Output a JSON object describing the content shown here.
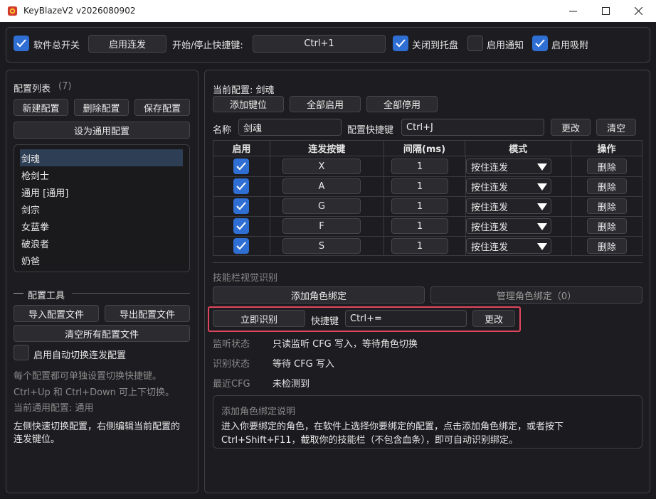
{
  "window": {
    "title": "KeyBlazeV2 v2026080902"
  },
  "toolbar": {
    "master_switch": {
      "label": "软件总开关",
      "checked": true
    },
    "enable_burst_button": "启用连发",
    "hotkey_label": "开始/停止快捷键:",
    "hotkey_value": "Ctrl+1",
    "close_to_tray": {
      "label": "关闭到托盘",
      "checked": true
    },
    "enable_notify": {
      "label": "启用通知",
      "checked": false
    },
    "enable_snap": {
      "label": "启用吸附",
      "checked": true
    }
  },
  "left": {
    "list_title": "配置列表",
    "list_count": "(7)",
    "new_button": "新建配置",
    "delete_button": "删除配置",
    "save_button": "保存配置",
    "set_general_button": "设为通用配置",
    "configs": [
      "剑魂",
      "枪剑士",
      "通用 [通用]",
      "剑宗",
      "女蓝拳",
      "破浪者",
      "奶爸"
    ],
    "selected_index": 0,
    "tools_title": "配置工具",
    "import_button": "导入配置文件",
    "export_button": "导出配置文件",
    "clear_button": "清空所有配置文件",
    "auto_switch": {
      "label": "启用自动切换连发配置",
      "checked": false
    },
    "hint1": "每个配置都可单独设置切换快捷键。",
    "hint2": "Ctrl+Up 和 Ctrl+Down 可上下切换。",
    "hint3": "当前通用配置: 通用",
    "hint4": "左侧快速切换配置，右侧编辑当前配置的",
    "hint5": "连发键位。"
  },
  "right": {
    "current_config": "当前配置: 剑魂",
    "add_key_button": "添加键位",
    "enable_all_button": "全部启用",
    "disable_all_button": "全部停用",
    "name_label": "名称",
    "name_value": "剑魂",
    "config_hotkey_label": "配置快捷键",
    "config_hotkey_value": "Ctrl+J",
    "change_button": "更改",
    "clear_button": "清空",
    "table": {
      "headers": [
        "启用",
        "连发按键",
        "间隔(ms)",
        "模式",
        "操作"
      ],
      "rows": [
        {
          "enabled": true,
          "key": "X",
          "interval": "1",
          "mode": "按住连发",
          "action": "删除"
        },
        {
          "enabled": true,
          "key": "A",
          "interval": "1",
          "mode": "按住连发",
          "action": "删除"
        },
        {
          "enabled": true,
          "key": "G",
          "interval": "1",
          "mode": "按住连发",
          "action": "删除"
        },
        {
          "enabled": true,
          "key": "F",
          "interval": "1",
          "mode": "按住连发",
          "action": "删除"
        },
        {
          "enabled": true,
          "key": "S",
          "interval": "1",
          "mode": "按住连发",
          "action": "删除"
        }
      ]
    },
    "vision_title": "技能栏视觉识别",
    "add_binding_button": "添加角色绑定",
    "manage_binding_button": "管理角色绑定（0）",
    "recognize_button": "立即识别",
    "recognize_hotkey_label": "快捷键",
    "recognize_hotkey_value": "Ctrl+=",
    "recognize_change_button": "更改",
    "listen_label": "监听状态",
    "listen_value": "只读监听 CFG 写入，等待角色切换",
    "recog_label": "识别状态",
    "recog_value": "等待 CFG 写入",
    "cfg_label": "最近CFG",
    "cfg_value": "未检测到",
    "help_title": "添加角色绑定说明",
    "help_line1": "进入你要绑定的角色，在软件上选择你要绑定的配置，点击添加角色绑定，或者按下",
    "help_line2": "Ctrl+Shift+F11，截取你的技能栏（不包含血条），即可自动识别绑定。"
  },
  "colors": {
    "accent": "#2f6fd4",
    "highlight": "#e0475e",
    "background": "#1b1b1f"
  }
}
